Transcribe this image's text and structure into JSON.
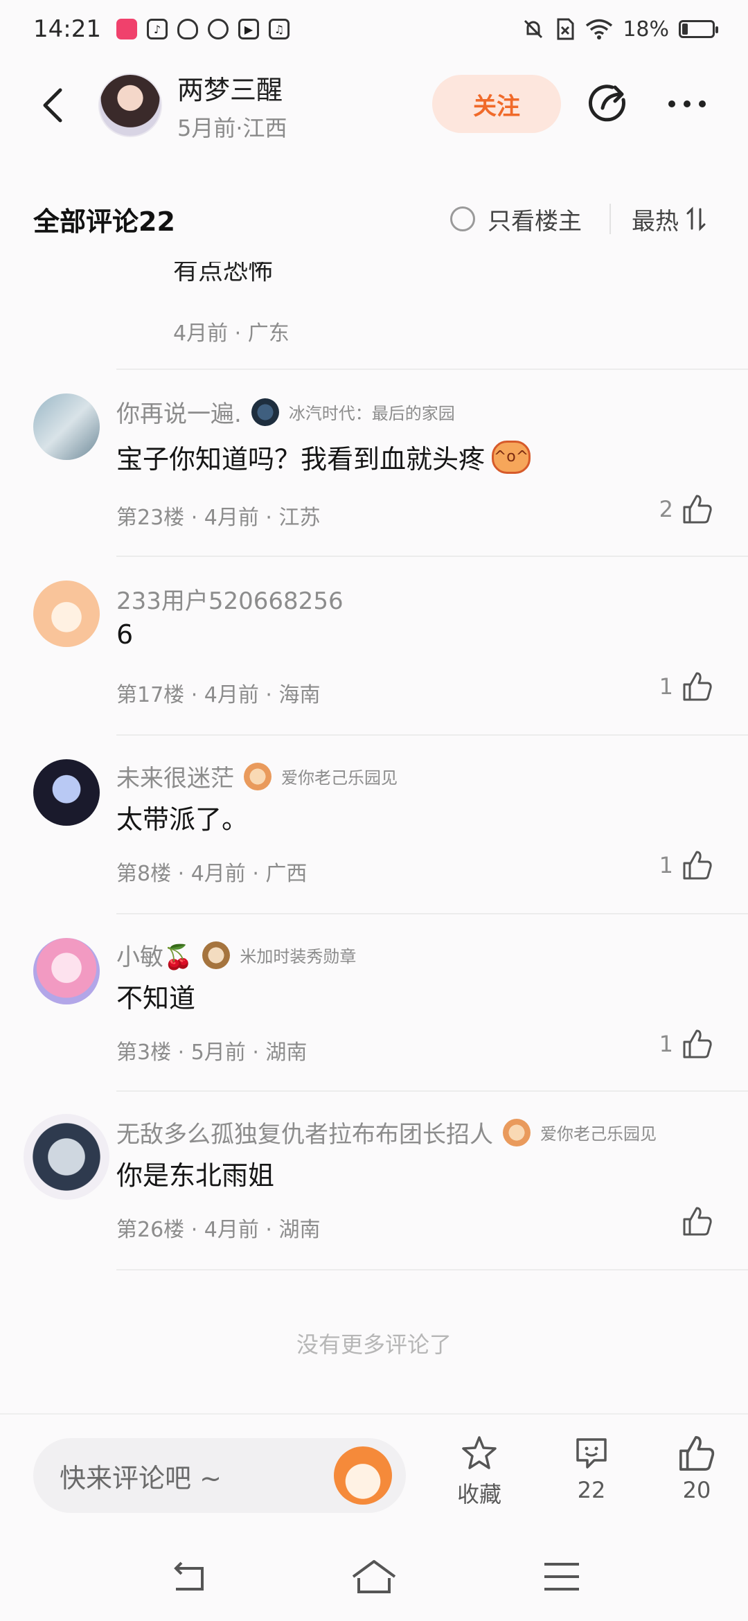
{
  "status_bar": {
    "time": "14:21",
    "battery_text": "18%",
    "battery_level": 0.18,
    "app_icons": [
      "kuaishou-icon",
      "tiktok-icon",
      "qq-icon",
      "link-icon",
      "video-icon",
      "music-icon"
    ]
  },
  "header": {
    "author_name": "两梦三醒",
    "author_meta": "5月前·江西",
    "follow_label": "关注"
  },
  "comments_header": {
    "title": "全部评论22",
    "only_host_label": "只看楼主",
    "sort_label": "最热"
  },
  "previous_comment": {
    "text_fragment": "有点恐怖",
    "meta": "4月前 · 广东"
  },
  "comments": [
    {
      "user": "你再说一遍.",
      "badge": "冰汽时代：最后的家园",
      "text": "宝子你知道吗？我看到血就头疼",
      "has_emoji": true,
      "meta": "第23楼 · 4月前 · 江苏",
      "likes": "2"
    },
    {
      "user": "233用户520668256",
      "badge": "",
      "text": "6",
      "has_emoji": false,
      "meta": "第17楼 · 4月前 · 海南",
      "likes": "1"
    },
    {
      "user": "未来很迷茫",
      "badge": "爱你老己乐园见",
      "text": "太带派了。",
      "has_emoji": false,
      "meta": "第8楼 · 4月前 · 广西",
      "likes": "1"
    },
    {
      "user": "小敏🍒",
      "badge": "米加时装秀勋章",
      "text": "不知道",
      "has_emoji": false,
      "meta": "第3楼 · 5月前 · 湖南",
      "likes": "1"
    },
    {
      "user": "无敌多么孤独复仇者拉布布团长招人",
      "badge": "爱你老己乐园见",
      "text": "你是东北雨姐",
      "has_emoji": false,
      "meta": "第26楼 · 4月前 · 湖南",
      "likes": ""
    }
  ],
  "footer_note": "没有更多评论了",
  "bottom_bar": {
    "input_placeholder": "快来评论吧 ~",
    "favorite_label": "收藏",
    "comment_count": "22",
    "like_count": "20"
  },
  "colors": {
    "accent": "#f06a2a",
    "follow_bg": "#fde6dd",
    "meta_gray": "#8c8c8c"
  }
}
